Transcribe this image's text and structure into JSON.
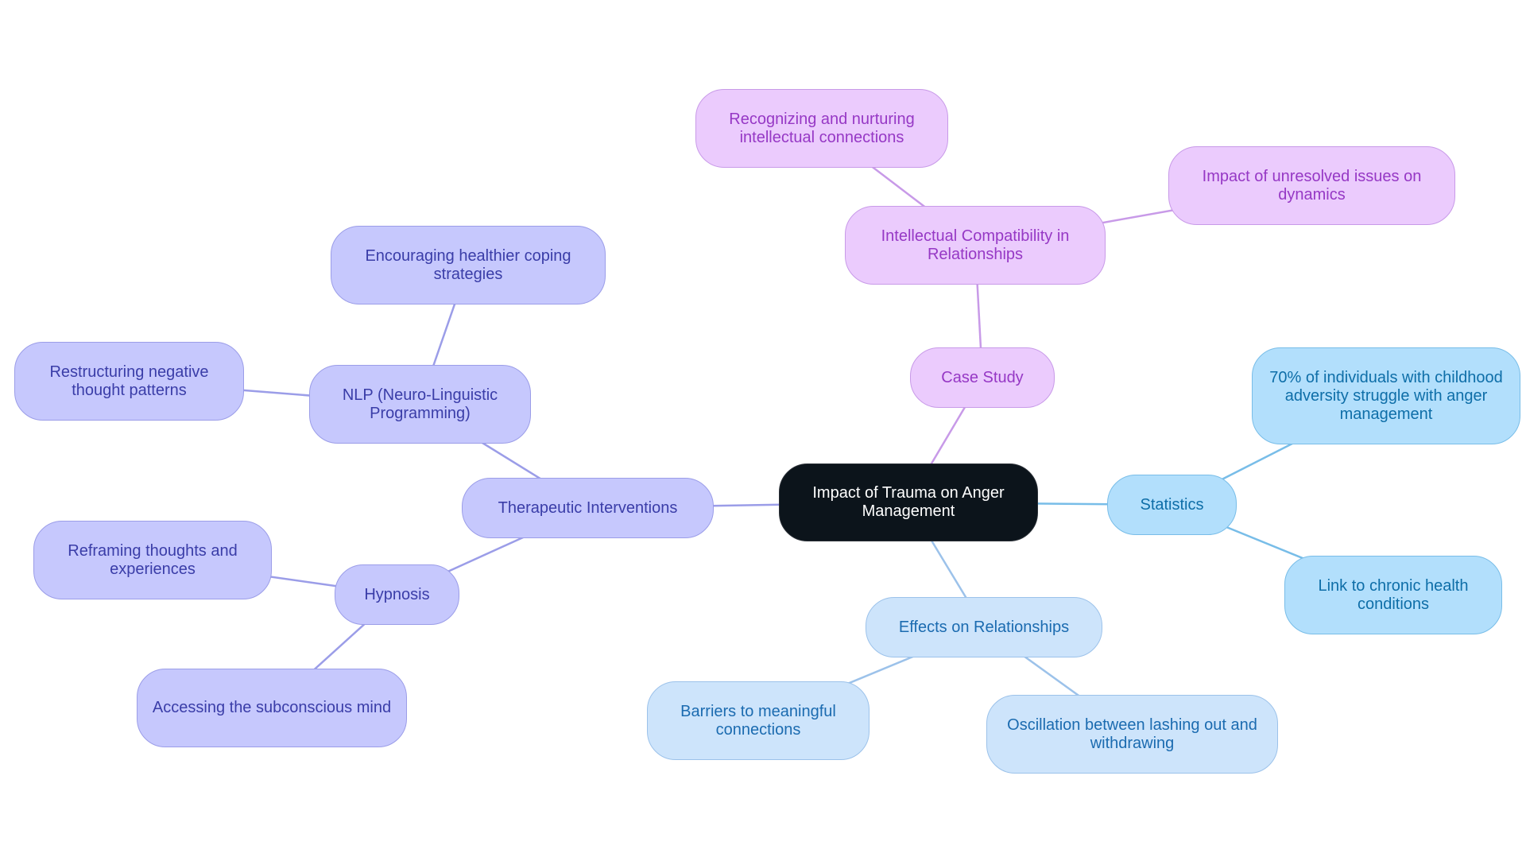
{
  "diagram": {
    "type": "mindmap",
    "root": {
      "id": "root",
      "label": "Impact of Trauma on Anger Management"
    },
    "colors": {
      "violet_fill": "#c6c8fd",
      "violet_text": "#3a3da8",
      "violet_edge": "#9b9de8",
      "purple_fill": "#ebcbfd",
      "purple_text": "#9638c5",
      "purple_edge": "#c89ae8",
      "sky_fill": "#b2dffc",
      "sky_text": "#0e6ea8",
      "sky_edge": "#78bde8",
      "pale_fill": "#cde4fb",
      "pale_text": "#1b6bb0",
      "pale_edge": "#9cc2ea",
      "root_fill": "#0c141b",
      "root_text": "#ffffff"
    },
    "nodes": [
      {
        "id": "root",
        "label": "Impact of Trauma on Anger Management",
        "parent": null,
        "theme": "root"
      },
      {
        "id": "therapeutic",
        "label": "Therapeutic Interventions",
        "parent": "root",
        "theme": "violet"
      },
      {
        "id": "nlp",
        "label": "NLP (Neuro-Linguistic Programming)",
        "parent": "therapeutic",
        "theme": "violet"
      },
      {
        "id": "coping",
        "label": "Encouraging healthier coping strategies",
        "parent": "nlp",
        "theme": "violet"
      },
      {
        "id": "restructuring",
        "label": "Restructuring negative thought patterns",
        "parent": "nlp",
        "theme": "violet"
      },
      {
        "id": "hypnosis",
        "label": "Hypnosis",
        "parent": "therapeutic",
        "theme": "violet"
      },
      {
        "id": "reframing",
        "label": "Reframing thoughts and experiences",
        "parent": "hypnosis",
        "theme": "violet"
      },
      {
        "id": "subconscious",
        "label": "Accessing the subconscious mind",
        "parent": "hypnosis",
        "theme": "violet"
      },
      {
        "id": "case",
        "label": "Case Study",
        "parent": "root",
        "theme": "purple"
      },
      {
        "id": "intellectual",
        "label": "Intellectual Compatibility in Relationships",
        "parent": "case",
        "theme": "purple"
      },
      {
        "id": "recognizing",
        "label": "Recognizing and nurturing intellectual connections",
        "parent": "intellectual",
        "theme": "purple"
      },
      {
        "id": "unresolved",
        "label": "Impact of unresolved issues on dynamics",
        "parent": "intellectual",
        "theme": "purple"
      },
      {
        "id": "statistics",
        "label": "Statistics",
        "parent": "root",
        "theme": "sky"
      },
      {
        "id": "seventy",
        "label": "70% of individuals with childhood adversity struggle with anger management",
        "parent": "statistics",
        "theme": "sky"
      },
      {
        "id": "chronic",
        "label": "Link to chronic health conditions",
        "parent": "statistics",
        "theme": "sky"
      },
      {
        "id": "effects",
        "label": "Effects on Relationships",
        "parent": "root",
        "theme": "pale"
      },
      {
        "id": "barriers",
        "label": "Barriers to meaningful connections",
        "parent": "effects",
        "theme": "pale"
      },
      {
        "id": "oscillation",
        "label": "Oscillation between lashing out and withdrawing",
        "parent": "effects",
        "theme": "pale"
      }
    ]
  }
}
